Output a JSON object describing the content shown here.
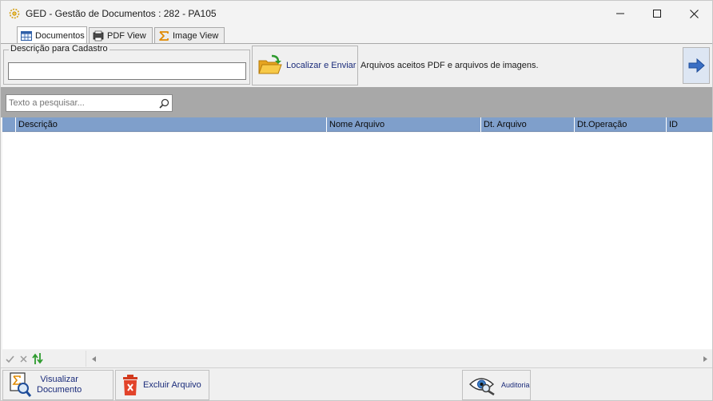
{
  "window": {
    "title": "GED - Gestão de Documentos : 282 - PA105"
  },
  "tabs": [
    {
      "label": "Documentos",
      "icon": "spreadsheet-icon",
      "active": true
    },
    {
      "label": "PDF View",
      "icon": "pdf-icon",
      "active": false
    },
    {
      "label": "Image View",
      "icon": "sigma-icon",
      "active": false
    }
  ],
  "cadastro": {
    "legend": "Descrição para Cadastro",
    "value": ""
  },
  "toolbar": {
    "localizar_label": "Localizar e Enviar",
    "info_text": "Arquivos aceitos PDF e arquivos de imagens."
  },
  "search": {
    "placeholder": "Texto a pesquisar..."
  },
  "grid": {
    "columns": [
      "Descrição",
      "Nome Arquivo",
      "Dt. Arquivo",
      "Dt.Operação",
      "ID"
    ],
    "rows": []
  },
  "bottom": {
    "visualizar_line1": "Visualizar",
    "visualizar_line2": "Documento",
    "excluir_label": "Excluir Arquivo",
    "auditoria_label": "Auditoria"
  },
  "colors": {
    "grid_header": "#7f9fcb",
    "search_bar": "#a8a8a8",
    "link_text": "#1a2b7a"
  }
}
